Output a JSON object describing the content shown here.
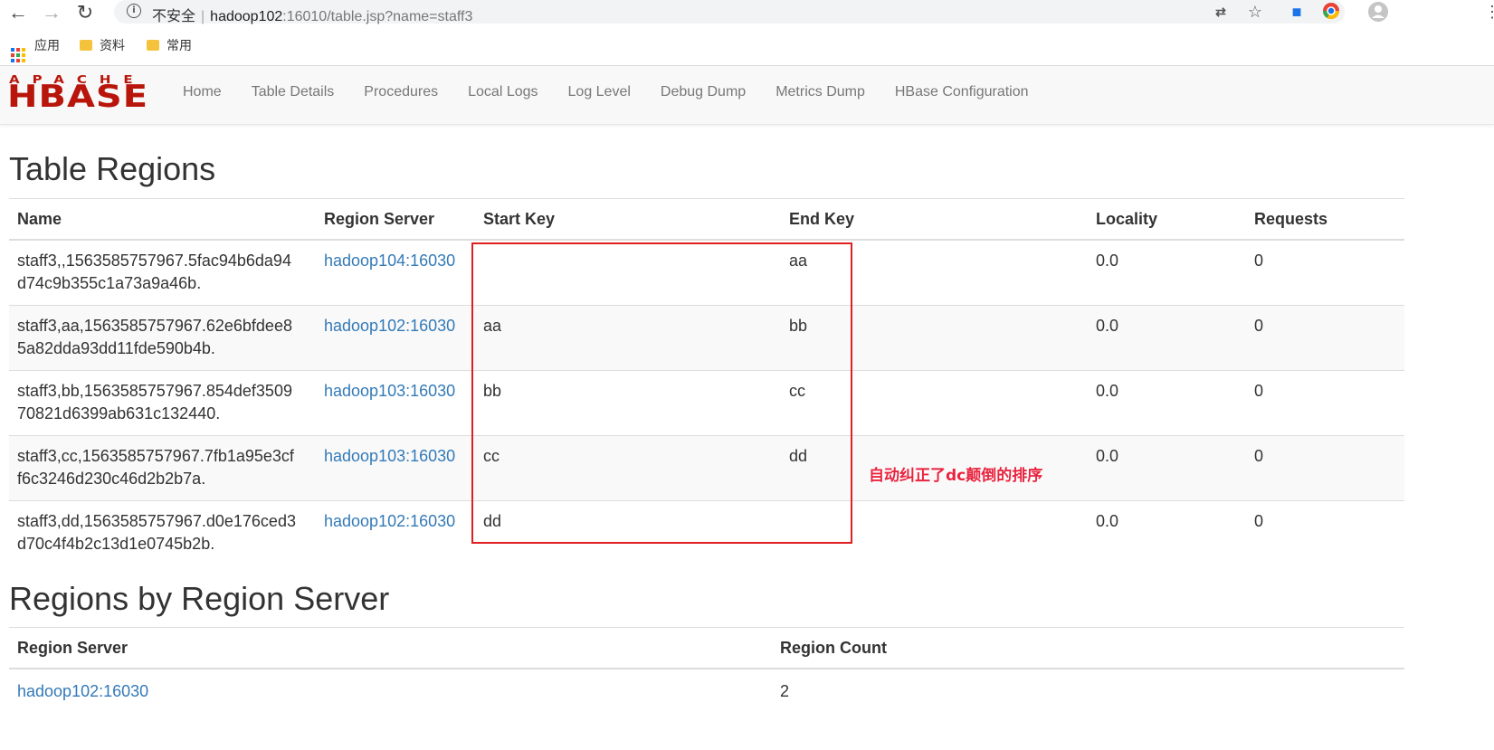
{
  "browser": {
    "back_icon": "←",
    "forward_icon": "→",
    "reload_icon": "↻",
    "security_text": "不安全",
    "url_host": "hadoop102",
    "url_rest": ":16010/table.jsp?name=staff3",
    "bookmarks": [
      {
        "label": "应用"
      },
      {
        "label": "资料"
      },
      {
        "label": "常用"
      }
    ]
  },
  "navbar": {
    "logo_top": "APACHE",
    "logo_main": "HBASE",
    "links": [
      "Home",
      "Table Details",
      "Procedures",
      "Local Logs",
      "Log Level",
      "Debug Dump",
      "Metrics Dump",
      "HBase Configuration"
    ]
  },
  "table_regions": {
    "title": "Table Regions",
    "headers": [
      "Name",
      "Region Server",
      "Start Key",
      "End Key",
      "Locality",
      "Requests"
    ],
    "rows": [
      {
        "name_1": "staff3,,1563585757967.5fac94b6da94",
        "name_2": "d74c9b355c1a73a9a46b.",
        "server": "hadoop104:16030",
        "start": "",
        "end": "aa",
        "locality": "0.0",
        "requests": "0"
      },
      {
        "name_1": "staff3,aa,1563585757967.62e6bfdee8",
        "name_2": "5a82dda93dd11fde590b4b.",
        "server": "hadoop102:16030",
        "start": "aa",
        "end": "bb",
        "locality": "0.0",
        "requests": "0"
      },
      {
        "name_1": "staff3,bb,1563585757967.854def3509",
        "name_2": "70821d6399ab631c132440.",
        "server": "hadoop103:16030",
        "start": "bb",
        "end": "cc",
        "locality": "0.0",
        "requests": "0"
      },
      {
        "name_1": "staff3,cc,1563585757967.7fb1a95e3cf",
        "name_2": "f6c3246d230c46d2b2b7a.",
        "server": "hadoop103:16030",
        "start": "cc",
        "end": "dd",
        "locality": "0.0",
        "requests": "0"
      },
      {
        "name_1": "staff3,dd,1563585757967.d0e176ced3",
        "name_2": "d70c4f4b2c13d1e0745b2b.",
        "server": "hadoop102:16030",
        "start": "dd",
        "end": "",
        "locality": "0.0",
        "requests": "0"
      }
    ]
  },
  "annotation": "自动纠正了dc颠倒的排序",
  "regions_by_server": {
    "title": "Regions by Region Server",
    "headers": [
      "Region Server",
      "Region Count"
    ],
    "rows": [
      {
        "server": "hadoop102:16030",
        "count": "2"
      }
    ]
  },
  "colors": {
    "accent_red": "#e02020",
    "hbase_red": "#b8160b",
    "link_blue": "#337ab7"
  }
}
